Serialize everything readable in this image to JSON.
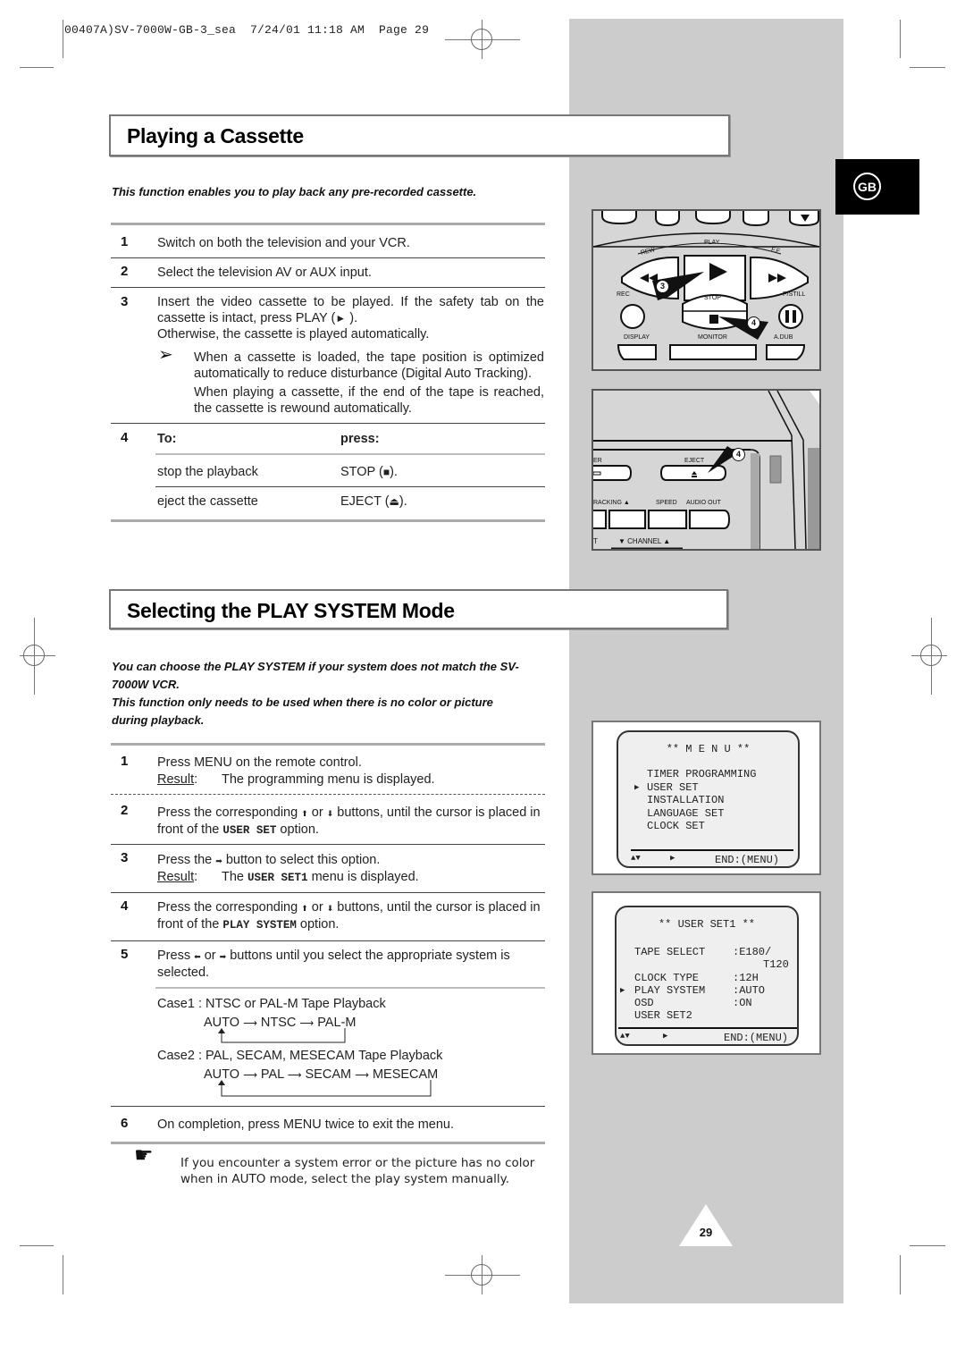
{
  "print_header": "00407A)SV-7000W-GB-3_sea  7/24/01 11:18 AM  Page 29",
  "language_badge": "GB",
  "page_number": "29",
  "section1": {
    "title": "Playing a Cassette",
    "intro": "This function enables you to play back any pre-recorded cassette.",
    "steps": [
      {
        "num": "1",
        "text": "Switch on both the television and your VCR."
      },
      {
        "num": "2",
        "text": "Select the television AV or AUX input."
      },
      {
        "num": "3",
        "text_a": "Insert the video cassette to be played. If the safety tab on the",
        "text_b": "cassette is intact, press PLAY (",
        "play_glyph": "►",
        "text_b_end": " ).",
        "text_c": "Otherwise, the cassette is played automatically.",
        "note_icon": "➢",
        "note_1": "When a cassette is loaded, the tape position is optimized automatically to reduce disturbance (Digital Auto Tracking).",
        "note_2": "When playing a cassette, if the end of the tape is reached, the cassette is rewound automatically."
      }
    ],
    "step4": {
      "num": "4",
      "col_to": "To:",
      "col_press": "press:",
      "rows": [
        {
          "action": "stop the playback",
          "button": "STOP (",
          "glyph": "■",
          "end": ")."
        },
        {
          "action": "eject the cassette",
          "button": "EJECT (",
          "glyph": "⏏",
          "end": ")."
        }
      ]
    }
  },
  "remote_illustration": {
    "labels": {
      "rew": "REW",
      "play": "PLAY",
      "ff": "F.F",
      "rec": "REC",
      "stop": "STOP",
      "pstill": "P/STILL",
      "display": "DISPLAY",
      "monitor": "MONITOR",
      "adub": "A.DUB"
    },
    "callouts": [
      "3",
      "4"
    ]
  },
  "vcr_illustration": {
    "labels": {
      "power": "ER",
      "eject": "EJECT",
      "tracking": "RACKING",
      "speed": "SPEED",
      "audio_out": "AUDIO OUT",
      "channel": "CHANNEL",
      "t": "T"
    },
    "callout": "4"
  },
  "section2": {
    "title": "Selecting the PLAY SYSTEM Mode",
    "intro_1": "You can choose the PLAY SYSTEM if your system does not match the SV-7000W VCR.",
    "intro_2": "This function only needs to be used when there is no color or picture during playback.",
    "steps": {
      "s1": {
        "num": "1",
        "text": "Press MENU on the remote control.",
        "result_label": "Result",
        "result_text": "The programming menu is displayed."
      },
      "s2": {
        "num": "2",
        "text_a": "Press the corresponding",
        "up": "⬆",
        "or": "or",
        "down": "⬇",
        "text_b": "buttons, until the cursor is placed in front of the",
        "code": "USER SET",
        "text_c": "option."
      },
      "s3": {
        "num": "3",
        "text_a": "Press the",
        "right": "➡",
        "text_b": "button to select this option.",
        "result_label": "Result",
        "result_pre": "The",
        "code": "USER SET1",
        "result_post": "menu is displayed."
      },
      "s4": {
        "num": "4",
        "text_a": "Press the corresponding",
        "up": "⬆",
        "or": "or",
        "down": "⬇",
        "text_b": "buttons, until the cursor is placed in front of the",
        "code": "PLAY SYSTEM",
        "text_c": "option."
      },
      "s5": {
        "num": "5",
        "text_a": "Press",
        "left": "⬅",
        "or": "or",
        "right": "➡",
        "text_b": "buttons until you select the appropriate system is selected.",
        "case1_title": "Case1 : NTSC or PAL-M Tape Playback",
        "case1_flow": [
          "AUTO",
          "NTSC",
          "PAL-M"
        ],
        "case2_title": "Case2 : PAL, SECAM, MESECAM Tape Playback",
        "case2_flow": [
          "AUTO",
          "PAL",
          "SECAM",
          "MESECAM"
        ]
      },
      "s6": {
        "num": "6",
        "text": "On completion, press MENU twice to exit the menu."
      }
    },
    "note_icon": "☛",
    "note": "If you encounter a system error or the picture has no color when in AUTO mode, select the play system manually."
  },
  "menu_screen": {
    "title": "** M E N U **",
    "items": [
      "TIMER PROGRAMMING",
      "USER SET",
      "INSTALLATION",
      "LANGUAGE SET",
      "CLOCK SET"
    ],
    "selected_index": 1,
    "footer_nav": "▲▼",
    "footer_select": "▶",
    "footer_end": "END:(MENU)"
  },
  "userset_screen": {
    "title": "** USER SET1 **",
    "rows": [
      {
        "label": "TAPE SELECT",
        "value": ":E180/"
      },
      {
        "label": "",
        "value": "T120"
      },
      {
        "label": "CLOCK TYPE",
        "value": ":12H"
      },
      {
        "label": "PLAY SYSTEM",
        "value": ":AUTO"
      },
      {
        "label": "OSD",
        "value": ":ON"
      },
      {
        "label": "USER SET2",
        "value": ""
      }
    ],
    "selected_label": "PLAY SYSTEM",
    "footer_nav": "▲▼",
    "footer_select": "▶",
    "footer_end": "END:(MENU)"
  }
}
